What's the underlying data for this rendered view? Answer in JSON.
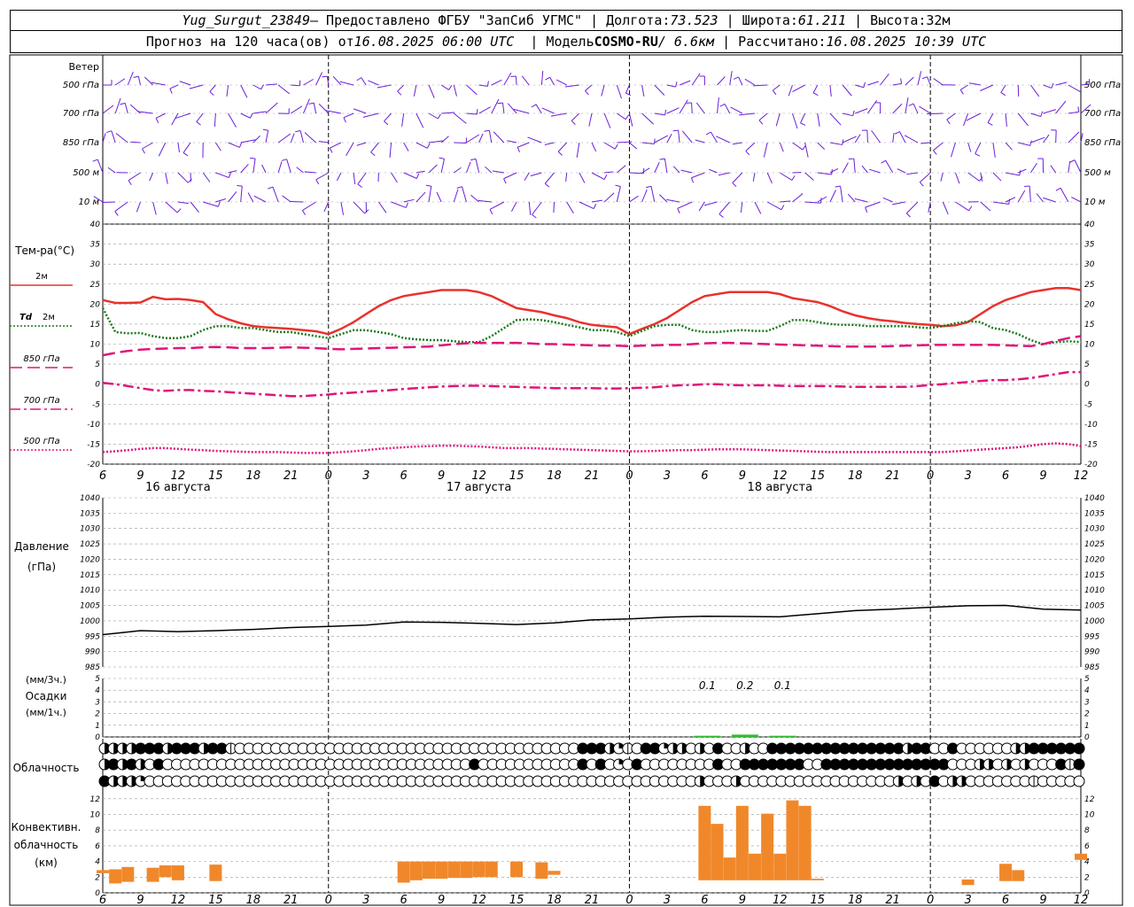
{
  "header": {
    "station": "Yug_Surgut_23849",
    "provided_by": "– Предоставлено ФГБУ \"ЗапСиб УГМС\"",
    "lon_label": "Долгота:",
    "lon": "73.523",
    "lat_label": "Широта:",
    "lat": "61.211",
    "alt_label": "Высота:",
    "alt": "32м",
    "forecast_label": "Прогноз на 120 часа(ов) от",
    "forecast_time": "16.08.2025 06:00 UTC",
    "model_label": "Модель",
    "model": "COSMO-RU",
    "model_res": "/ 6.6км",
    "calc_label": "Рассчитано:",
    "calc_time": "16.08.2025 10:39 UTC"
  },
  "chart_data": [
    {
      "type": "wind-barbs",
      "title": "Ветер",
      "levels": [
        "500 гПа",
        "700 гПа",
        "850 гПа",
        "500 м",
        "10 м"
      ]
    },
    {
      "type": "line",
      "title": "Тем-ра(°C)",
      "ylim": [
        -20,
        40
      ],
      "yticks": [
        -20,
        -15,
        -10,
        -5,
        0,
        5,
        10,
        15,
        20,
        25,
        30,
        35,
        40
      ],
      "x_hours_from_start": [
        0,
        1,
        2,
        3,
        4,
        5,
        6,
        7,
        8,
        9,
        10,
        11,
        12,
        13,
        14,
        15,
        16,
        17,
        18,
        19,
        20,
        21,
        22,
        23,
        24,
        25,
        26,
        27,
        28,
        29,
        30,
        31,
        32,
        33,
        34,
        35,
        36,
        37,
        38,
        39,
        40,
        41,
        42,
        43,
        44,
        45,
        46,
        47,
        48,
        49,
        50,
        51,
        52,
        53,
        54,
        55,
        56,
        57,
        58,
        59,
        60,
        61,
        62,
        63,
        64,
        65,
        66,
        67,
        68,
        69,
        70,
        71,
        72,
        73,
        74,
        75,
        76,
        77,
        78
      ],
      "series": [
        {
          "name": "2м",
          "color": "#e8322d",
          "style": "solid",
          "values": [
            21,
            20.3,
            20.3,
            20.4,
            21.8,
            21.2,
            21.3,
            21,
            20.5,
            17.5,
            16.2,
            15.2,
            14.5,
            14.2,
            14,
            13.8,
            13.5,
            13.2,
            12.5,
            13.8,
            15.5,
            17.5,
            19.5,
            21,
            22,
            22.5,
            23,
            23.5,
            23.5,
            23.5,
            23,
            22,
            20.5,
            19,
            18.5,
            18,
            17.2,
            16.5,
            15.5,
            14.8,
            14.5,
            14.2,
            12.5,
            13.8,
            15,
            16.5,
            18.5,
            20.5,
            22,
            22.5,
            23,
            23,
            23,
            23,
            22.5,
            21.5,
            21,
            20.5,
            19.5,
            18.2,
            17.2,
            16.5,
            16,
            15.7,
            15.3,
            15,
            14.8,
            14.5,
            14.7,
            15.5,
            17.5,
            19.5,
            21,
            22,
            23,
            23.5,
            24,
            24,
            23.5
          ]
        },
        {
          "name": "Td 2м",
          "color": "#1a7a1a",
          "style": "dotted",
          "values": [
            19,
            13,
            12.7,
            12.8,
            12,
            11.5,
            11.5,
            12,
            13.5,
            14.5,
            14.5,
            14,
            14,
            13.5,
            13,
            13,
            12.5,
            12,
            11.5,
            12.5,
            13.5,
            13.5,
            13,
            12.5,
            11.5,
            11.2,
            11,
            11,
            10.7,
            10.5,
            10.5,
            12,
            14,
            16,
            16.2,
            16,
            15.5,
            14.8,
            14.2,
            13.5,
            13.5,
            13,
            12,
            13.3,
            14.5,
            14.8,
            14.8,
            13.5,
            13,
            13,
            13.3,
            13.5,
            13.3,
            13.3,
            14.5,
            16,
            16,
            15.5,
            15,
            14.8,
            14.8,
            14.5,
            14.5,
            14.5,
            14.5,
            14.2,
            14,
            14.5,
            15.2,
            15.7,
            15.5,
            14,
            13.5,
            12.5,
            11,
            10,
            10.5,
            10.7,
            10.5
          ]
        },
        {
          "name": "850 гПа",
          "color": "#e0157a",
          "style": "longdash",
          "values": [
            7.2,
            7.8,
            8.3,
            8.6,
            8.8,
            8.9,
            9,
            9,
            9.2,
            9.3,
            9.2,
            9,
            9,
            9,
            9.1,
            9.2,
            9.1,
            9,
            8.8,
            8.7,
            8.8,
            8.9,
            9,
            9.1,
            9.2,
            9.3,
            9.4,
            9.7,
            10,
            10.2,
            10.3,
            10.3,
            10.3,
            10.3,
            10.2,
            10,
            10,
            9.9,
            9.8,
            9.7,
            9.6,
            9.6,
            9.5,
            9.6,
            9.7,
            9.8,
            9.8,
            10,
            10.2,
            10.3,
            10.3,
            10.2,
            10.1,
            10,
            9.9,
            9.8,
            9.7,
            9.6,
            9.5,
            9.4,
            9.4,
            9.4,
            9.4,
            9.5,
            9.6,
            9.7,
            9.8,
            9.8,
            9.8,
            9.8,
            9.8,
            9.8,
            9.7,
            9.6,
            9.5,
            10,
            10.8,
            11.5,
            12
          ]
        },
        {
          "name": "700 гПа",
          "color": "#e0157a",
          "style": "dashdot",
          "values": [
            0.3,
            0,
            -0.5,
            -1,
            -1.5,
            -1.7,
            -1.5,
            -1.5,
            -1.7,
            -1.8,
            -2,
            -2.2,
            -2.4,
            -2.6,
            -2.8,
            -3,
            -3,
            -2.8,
            -2.6,
            -2.3,
            -2.1,
            -1.9,
            -1.7,
            -1.5,
            -1.2,
            -1,
            -0.8,
            -0.6,
            -0.5,
            -0.4,
            -0.4,
            -0.5,
            -0.6,
            -0.7,
            -0.8,
            -0.9,
            -1,
            -1,
            -1,
            -1,
            -1.1,
            -1.1,
            -1,
            -0.9,
            -0.8,
            -0.5,
            -0.3,
            -0.2,
            0,
            0,
            -0.2,
            -0.3,
            -0.3,
            -0.3,
            -0.4,
            -0.5,
            -0.5,
            -0.5,
            -0.5,
            -0.6,
            -0.7,
            -0.7,
            -0.7,
            -0.7,
            -0.7,
            -0.5,
            -0.2,
            0,
            0.3,
            0.5,
            0.8,
            1,
            1,
            1.2,
            1.5,
            2,
            2.5,
            3,
            3
          ]
        },
        {
          "name": "500 гПа",
          "color": "#e0157a",
          "style": "dotted",
          "values": [
            -17,
            -16.8,
            -16.5,
            -16.2,
            -16,
            -16,
            -16.2,
            -16.4,
            -16.5,
            -16.7,
            -16.8,
            -16.9,
            -17,
            -17,
            -17,
            -17.1,
            -17.2,
            -17.2,
            -17.2,
            -17,
            -16.8,
            -16.5,
            -16.2,
            -16,
            -15.8,
            -15.6,
            -15.5,
            -15.4,
            -15.4,
            -15.5,
            -15.6,
            -15.8,
            -16,
            -16,
            -16,
            -16.1,
            -16.2,
            -16.3,
            -16.4,
            -16.5,
            -16.6,
            -16.7,
            -16.8,
            -16.8,
            -16.7,
            -16.6,
            -16.5,
            -16.5,
            -16.4,
            -16.3,
            -16.3,
            -16.3,
            -16.4,
            -16.5,
            -16.6,
            -16.7,
            -16.8,
            -16.9,
            -17,
            -17,
            -17,
            -17,
            -17,
            -17,
            -17,
            -17,
            -17,
            -17,
            -16.8,
            -16.6,
            -16.4,
            -16.2,
            -16,
            -15.8,
            -15.4,
            -15,
            -14.8,
            -15,
            -15.5
          ]
        }
      ]
    },
    {
      "type": "line",
      "title": "Давление",
      "ylabel": "(гПа)",
      "ylim": [
        985,
        1040
      ],
      "yticks": [
        985,
        990,
        995,
        1000,
        1005,
        1010,
        1015,
        1020,
        1025,
        1030,
        1035,
        1040
      ],
      "x_hours_from_start": [
        0,
        3,
        6,
        9,
        12,
        15,
        18,
        21,
        24,
        27,
        30,
        33,
        36,
        39,
        42,
        45,
        48,
        51,
        54,
        57,
        60,
        63,
        66,
        69,
        72,
        75,
        78
      ],
      "series": [
        {
          "name": "",
          "color": "#000000",
          "values": [
            995.5,
            996.8,
            996.5,
            996.8,
            997.2,
            997.8,
            998.2,
            998.6,
            999.6,
            999.5,
            999.2,
            998.8,
            999.3,
            1000.3,
            1000.6,
            1001.2,
            1001.5,
            1001.4,
            1001.3,
            1002.3,
            1003.3,
            1003.8,
            1004.4,
            1004.9,
            1005,
            1003.8,
            1003.5
          ]
        }
      ]
    },
    {
      "type": "bar",
      "title": "Осадки",
      "ylabel": "(мм/3ч.) (мм/1ч.)",
      "ylim": [
        0,
        5
      ],
      "yticks": [
        0,
        1,
        2,
        3,
        4,
        5
      ],
      "annotations": [
        "0.1",
        "0.2",
        "0.1"
      ],
      "x_hours_from_start": [
        48,
        51,
        54
      ],
      "values": [
        0.1,
        0.2,
        0.1
      ]
    },
    {
      "type": "table",
      "title": "Облачность",
      "rows": [
        "3333444344434410000000000000000000000000000000000000044432104423303040030044444444444444434400400000033444444",
        "3434304000000000000000000000000000000000040000000000040402040000000040044444440044444444444444000330303000414",
        "4333200000000000000000000000000000000000000000000000000000000000003000300000000000000000303040330000000100000"
      ]
    },
    {
      "type": "bar",
      "title": "Конвективн. облачность (км)",
      "ylim": [
        0,
        13
      ],
      "yticks": [
        0,
        2,
        4,
        6,
        8,
        10,
        12
      ],
      "x_hours_from_start": [
        0,
        1,
        2,
        4,
        5,
        6,
        9,
        24,
        25,
        26,
        27,
        28,
        29,
        30,
        31,
        33,
        35,
        36,
        48,
        49,
        50,
        51,
        52,
        53,
        54,
        55,
        56,
        57,
        69,
        72,
        73,
        78
      ],
      "base": [
        2.5,
        1.2,
        1.4,
        1.4,
        2,
        1.6,
        1.5,
        1.3,
        1.6,
        1.8,
        1.8,
        1.9,
        1.9,
        2,
        2,
        2,
        1.8,
        2.3,
        1.6,
        1.6,
        1.6,
        1.6,
        1.6,
        1.6,
        1.6,
        1.6,
        1.6,
        1.6,
        1,
        1.5,
        1.5,
        4.2
      ],
      "top": [
        2.9,
        3.0,
        3.3,
        3.2,
        3.5,
        3.5,
        3.6,
        4.0,
        4.0,
        4.0,
        4.0,
        4.0,
        4.0,
        4.0,
        4.0,
        4.0,
        3.9,
        2.8,
        11.1,
        8.8,
        4.5,
        11.1,
        5.0,
        10.1,
        5.0,
        11.8,
        11.1,
        1.8,
        1.7,
        3.7,
        2.9,
        5.0
      ]
    }
  ],
  "xaxis": {
    "hour_labels": [
      "6",
      "9",
      "12",
      "15",
      "18",
      "21",
      "0",
      "3",
      "6",
      "9",
      "12",
      "15",
      "18",
      "21",
      "0",
      "3",
      "6",
      "9",
      "12",
      "15",
      "18",
      "21",
      "0",
      "3",
      "6",
      "9",
      "12"
    ],
    "date_labels": [
      "16 августа",
      "17 августа",
      "18 августа"
    ]
  },
  "legend": {
    "t2m": "2м",
    "td_a": "Td",
    "td_b": "2м",
    "t850": "850 гПа",
    "t700": "700 гПа",
    "t500": "500 гПа"
  },
  "colors": {
    "wind": "#6a1fd8",
    "t2m": "#e8322d",
    "td": "#1a7a1a",
    "upper": "#e0157a",
    "pressure": "#000000",
    "precip": "#2fbf2f",
    "conv": "#f0882a",
    "grid": "#9a9a9a"
  }
}
